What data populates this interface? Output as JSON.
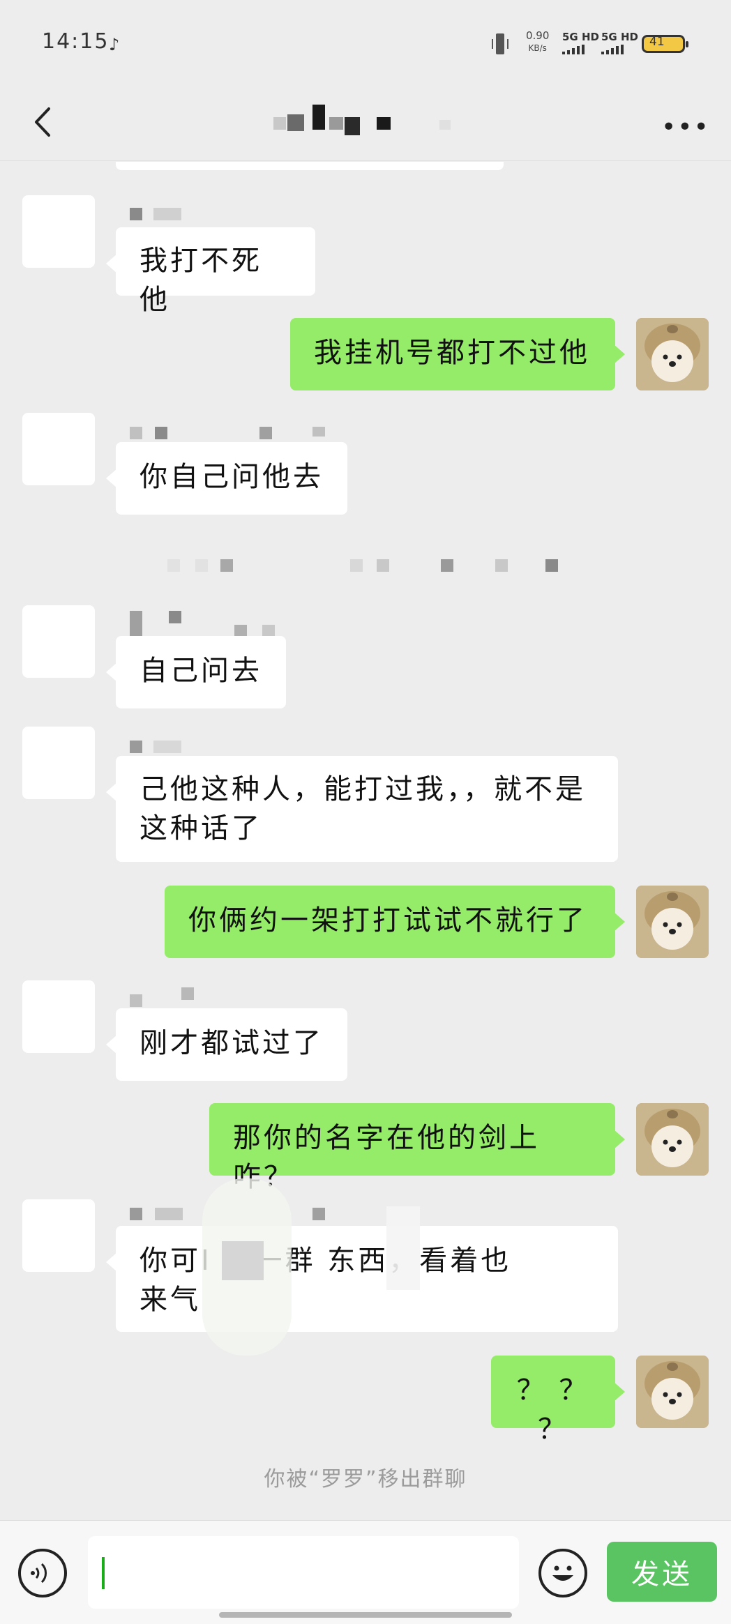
{
  "status_bar": {
    "time": "14:15",
    "net_speed_value": "0.90",
    "net_speed_unit": "KB/s",
    "signal_1": "5G HD",
    "signal_2": "5G HD",
    "battery": "41"
  },
  "header": {
    "title": ""
  },
  "messages": [
    {
      "side": "left",
      "text": "我打不死他"
    },
    {
      "side": "right",
      "text": "我挂机号都打不过他"
    },
    {
      "side": "left",
      "text": "你自己问他去"
    },
    {
      "side": "left",
      "text": "自己问去"
    },
    {
      "side": "left",
      "text_line1": "己他这种人，能打过我，，就不是",
      "text_line2": "这种话了"
    },
    {
      "side": "right",
      "text": "你俩约一架打打试试不就行了"
    },
    {
      "side": "left",
      "text": "刚才都试过了"
    },
    {
      "side": "right",
      "text": "那你的名字在他的剑上咋？"
    },
    {
      "side": "left",
      "text_line1": "你可I          ，一群    东西，看着也",
      "text_line2": "来气"
    },
    {
      "side": "right",
      "text": "？ ？ ？"
    }
  ],
  "system_message": "你被“罗罗”移出群聊",
  "input_bar": {
    "placeholder": "",
    "send_label": "发送"
  },
  "colors": {
    "background": "#ededed",
    "self_bubble": "#95ec69",
    "other_bubble": "#ffffff",
    "send_button": "#5ac463"
  },
  "icons": [
    "back-arrow-icon",
    "more-dots-icon",
    "voice-icon",
    "emoji-icon",
    "vibrate-icon",
    "battery-icon"
  ]
}
